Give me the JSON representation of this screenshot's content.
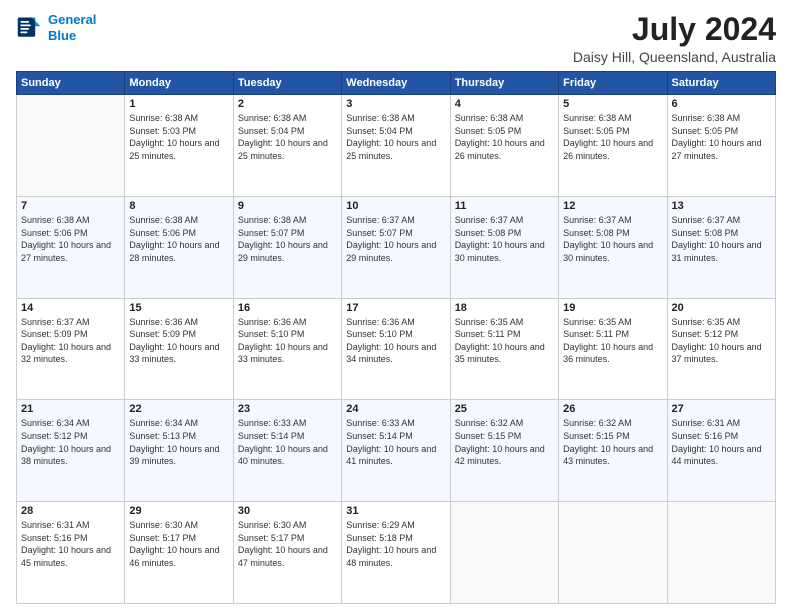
{
  "header": {
    "logo_line1": "General",
    "logo_line2": "Blue",
    "month_year": "July 2024",
    "location": "Daisy Hill, Queensland, Australia"
  },
  "days": [
    "Sunday",
    "Monday",
    "Tuesday",
    "Wednesday",
    "Thursday",
    "Friday",
    "Saturday"
  ],
  "weeks": [
    [
      {
        "date": "",
        "sunrise": "",
        "sunset": "",
        "daylight": ""
      },
      {
        "date": "1",
        "sunrise": "Sunrise: 6:38 AM",
        "sunset": "Sunset: 5:03 PM",
        "daylight": "Daylight: 10 hours and 25 minutes."
      },
      {
        "date": "2",
        "sunrise": "Sunrise: 6:38 AM",
        "sunset": "Sunset: 5:04 PM",
        "daylight": "Daylight: 10 hours and 25 minutes."
      },
      {
        "date": "3",
        "sunrise": "Sunrise: 6:38 AM",
        "sunset": "Sunset: 5:04 PM",
        "daylight": "Daylight: 10 hours and 25 minutes."
      },
      {
        "date": "4",
        "sunrise": "Sunrise: 6:38 AM",
        "sunset": "Sunset: 5:05 PM",
        "daylight": "Daylight: 10 hours and 26 minutes."
      },
      {
        "date": "5",
        "sunrise": "Sunrise: 6:38 AM",
        "sunset": "Sunset: 5:05 PM",
        "daylight": "Daylight: 10 hours and 26 minutes."
      },
      {
        "date": "6",
        "sunrise": "Sunrise: 6:38 AM",
        "sunset": "Sunset: 5:05 PM",
        "daylight": "Daylight: 10 hours and 27 minutes."
      }
    ],
    [
      {
        "date": "7",
        "sunrise": "Sunrise: 6:38 AM",
        "sunset": "Sunset: 5:06 PM",
        "daylight": "Daylight: 10 hours and 27 minutes."
      },
      {
        "date": "8",
        "sunrise": "Sunrise: 6:38 AM",
        "sunset": "Sunset: 5:06 PM",
        "daylight": "Daylight: 10 hours and 28 minutes."
      },
      {
        "date": "9",
        "sunrise": "Sunrise: 6:38 AM",
        "sunset": "Sunset: 5:07 PM",
        "daylight": "Daylight: 10 hours and 29 minutes."
      },
      {
        "date": "10",
        "sunrise": "Sunrise: 6:37 AM",
        "sunset": "Sunset: 5:07 PM",
        "daylight": "Daylight: 10 hours and 29 minutes."
      },
      {
        "date": "11",
        "sunrise": "Sunrise: 6:37 AM",
        "sunset": "Sunset: 5:08 PM",
        "daylight": "Daylight: 10 hours and 30 minutes."
      },
      {
        "date": "12",
        "sunrise": "Sunrise: 6:37 AM",
        "sunset": "Sunset: 5:08 PM",
        "daylight": "Daylight: 10 hours and 30 minutes."
      },
      {
        "date": "13",
        "sunrise": "Sunrise: 6:37 AM",
        "sunset": "Sunset: 5:08 PM",
        "daylight": "Daylight: 10 hours and 31 minutes."
      }
    ],
    [
      {
        "date": "14",
        "sunrise": "Sunrise: 6:37 AM",
        "sunset": "Sunset: 5:09 PM",
        "daylight": "Daylight: 10 hours and 32 minutes."
      },
      {
        "date": "15",
        "sunrise": "Sunrise: 6:36 AM",
        "sunset": "Sunset: 5:09 PM",
        "daylight": "Daylight: 10 hours and 33 minutes."
      },
      {
        "date": "16",
        "sunrise": "Sunrise: 6:36 AM",
        "sunset": "Sunset: 5:10 PM",
        "daylight": "Daylight: 10 hours and 33 minutes."
      },
      {
        "date": "17",
        "sunrise": "Sunrise: 6:36 AM",
        "sunset": "Sunset: 5:10 PM",
        "daylight": "Daylight: 10 hours and 34 minutes."
      },
      {
        "date": "18",
        "sunrise": "Sunrise: 6:35 AM",
        "sunset": "Sunset: 5:11 PM",
        "daylight": "Daylight: 10 hours and 35 minutes."
      },
      {
        "date": "19",
        "sunrise": "Sunrise: 6:35 AM",
        "sunset": "Sunset: 5:11 PM",
        "daylight": "Daylight: 10 hours and 36 minutes."
      },
      {
        "date": "20",
        "sunrise": "Sunrise: 6:35 AM",
        "sunset": "Sunset: 5:12 PM",
        "daylight": "Daylight: 10 hours and 37 minutes."
      }
    ],
    [
      {
        "date": "21",
        "sunrise": "Sunrise: 6:34 AM",
        "sunset": "Sunset: 5:12 PM",
        "daylight": "Daylight: 10 hours and 38 minutes."
      },
      {
        "date": "22",
        "sunrise": "Sunrise: 6:34 AM",
        "sunset": "Sunset: 5:13 PM",
        "daylight": "Daylight: 10 hours and 39 minutes."
      },
      {
        "date": "23",
        "sunrise": "Sunrise: 6:33 AM",
        "sunset": "Sunset: 5:14 PM",
        "daylight": "Daylight: 10 hours and 40 minutes."
      },
      {
        "date": "24",
        "sunrise": "Sunrise: 6:33 AM",
        "sunset": "Sunset: 5:14 PM",
        "daylight": "Daylight: 10 hours and 41 minutes."
      },
      {
        "date": "25",
        "sunrise": "Sunrise: 6:32 AM",
        "sunset": "Sunset: 5:15 PM",
        "daylight": "Daylight: 10 hours and 42 minutes."
      },
      {
        "date": "26",
        "sunrise": "Sunrise: 6:32 AM",
        "sunset": "Sunset: 5:15 PM",
        "daylight": "Daylight: 10 hours and 43 minutes."
      },
      {
        "date": "27",
        "sunrise": "Sunrise: 6:31 AM",
        "sunset": "Sunset: 5:16 PM",
        "daylight": "Daylight: 10 hours and 44 minutes."
      }
    ],
    [
      {
        "date": "28",
        "sunrise": "Sunrise: 6:31 AM",
        "sunset": "Sunset: 5:16 PM",
        "daylight": "Daylight: 10 hours and 45 minutes."
      },
      {
        "date": "29",
        "sunrise": "Sunrise: 6:30 AM",
        "sunset": "Sunset: 5:17 PM",
        "daylight": "Daylight: 10 hours and 46 minutes."
      },
      {
        "date": "30",
        "sunrise": "Sunrise: 6:30 AM",
        "sunset": "Sunset: 5:17 PM",
        "daylight": "Daylight: 10 hours and 47 minutes."
      },
      {
        "date": "31",
        "sunrise": "Sunrise: 6:29 AM",
        "sunset": "Sunset: 5:18 PM",
        "daylight": "Daylight: 10 hours and 48 minutes."
      },
      {
        "date": "",
        "sunrise": "",
        "sunset": "",
        "daylight": ""
      },
      {
        "date": "",
        "sunrise": "",
        "sunset": "",
        "daylight": ""
      },
      {
        "date": "",
        "sunrise": "",
        "sunset": "",
        "daylight": ""
      }
    ]
  ]
}
